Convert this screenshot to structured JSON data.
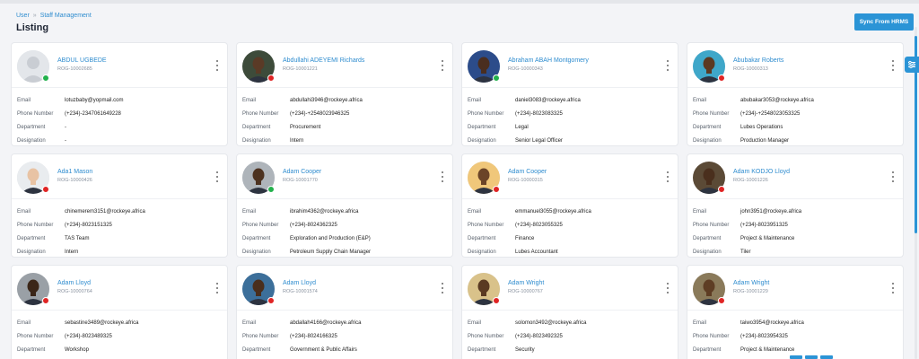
{
  "breadcrumb": {
    "items": [
      "User",
      "Staff Management"
    ],
    "separator": "»"
  },
  "page": {
    "title": "Listing"
  },
  "sync_button": {
    "label": "Sync From HRMS"
  },
  "labels": {
    "email": "Email",
    "phone": "Phone Number",
    "department": "Department",
    "designation": "Designation"
  },
  "colors": {
    "accent": "#2b94d6",
    "online": "#22b14c",
    "offline": "#e02424"
  },
  "staff": [
    {
      "name": "ABDUL UGBEDE",
      "code": "ROG-10002685",
      "status": "online",
      "email": "lotuzbaby@yopmail.com",
      "phone": "(+234)-2347061649228",
      "department": "-",
      "designation": "-",
      "avatar": "placeholder",
      "skin": "#c9cdd3"
    },
    {
      "name": "Abdullahi ADEYEMI Richards",
      "code": "ROG-10001221",
      "status": "offline",
      "email": "abdullahi3946@rockeye.africa",
      "phone": "(+234)-+2548023946325",
      "department": "Procurement",
      "designation": "Intern",
      "avatar": "photo",
      "skin": "#5a3a26",
      "bg": "#3d4b3a"
    },
    {
      "name": "Abraham ABAH Montgomery",
      "code": "ROG-10000343",
      "status": "online",
      "email": "daniel3083@rockeye.africa",
      "phone": "(+234)-8023083325",
      "department": "Legal",
      "designation": "Senior Legal Officer",
      "avatar": "photo",
      "skin": "#4a2e1f",
      "bg": "#2c4c8a"
    },
    {
      "name": "Abubakar Roberts",
      "code": "ROG-10000313",
      "status": "offline",
      "email": "abubakar3053@rockeye.africa",
      "phone": "(+234)-+2548023053325",
      "department": "Lubes Operations",
      "designation": "Production Manager",
      "avatar": "photo",
      "skin": "#5c3a22",
      "bg": "#3fa7c9"
    },
    {
      "name": "Ada1 Mason",
      "code": "ROG-10000426",
      "status": "offline",
      "email": "chinemerem3151@rockeye.africa",
      "phone": "(+234)-8023151325",
      "department": "TAS Team",
      "designation": "Intern",
      "avatar": "photo",
      "skin": "#e8c3a4",
      "bg": "#e9ecef"
    },
    {
      "name": "Adam Cooper",
      "code": "ROG-10001770",
      "status": "online",
      "email": "ibrahim4362@rockeye.africa",
      "phone": "(+234)-8024362325",
      "department": "Exploration and Production (E&P)",
      "designation": "Petroleum Supply Chain Manager",
      "avatar": "photo",
      "skin": "#4d3220",
      "bg": "#aeb4ba"
    },
    {
      "name": "Adam Cooper",
      "code": "ROG-10000315",
      "status": "offline",
      "email": "emmanuel3055@rockeye.africa",
      "phone": "(+234)-8023055325",
      "department": "Finance",
      "designation": "Lubes Accountant",
      "avatar": "photo",
      "skin": "#6b4428",
      "bg": "#f0c77a"
    },
    {
      "name": "Adam KODJO Lloyd",
      "code": "ROG-10001226",
      "status": "offline",
      "email": "john3951@rockeye.africa",
      "phone": "(+234)-8023951325",
      "department": "Project & Maintenance",
      "designation": "Tiler",
      "avatar": "photo",
      "skin": "#4a2f1d",
      "bg": "#5b4a36"
    },
    {
      "name": "Adam Lloyd",
      "code": "ROG-10000764",
      "status": "offline",
      "email": "sebastine3489@rockeye.africa",
      "phone": "(+234)-8023489325",
      "department": "Workshop",
      "designation": "",
      "avatar": "photo",
      "skin": "#3b2618",
      "bg": "#9aa0a6"
    },
    {
      "name": "Adam Lloyd",
      "code": "ROG-10001574",
      "status": "offline",
      "email": "abdallah4166@rockeye.africa",
      "phone": "(+234)-8024166325",
      "department": "Government & Public Affairs",
      "designation": "",
      "avatar": "photo",
      "skin": "#4a2e1c",
      "bg": "#3c6f9a"
    },
    {
      "name": "Adam Wright",
      "code": "ROG-10000767",
      "status": "offline",
      "email": "solomon3492@rockeye.africa",
      "phone": "(+234)-8023492325",
      "department": "Security",
      "designation": "",
      "avatar": "photo",
      "skin": "#5a3a22",
      "bg": "#d9c28a"
    },
    {
      "name": "Adam Wright",
      "code": "ROG-10001229",
      "status": "offline",
      "email": "taiwo3954@rockeye.africa",
      "phone": "(+234)-8023954325",
      "department": "Project & Maintenance",
      "designation": "",
      "avatar": "photo",
      "skin": "#5e3d24",
      "bg": "#8a7a5a"
    }
  ]
}
